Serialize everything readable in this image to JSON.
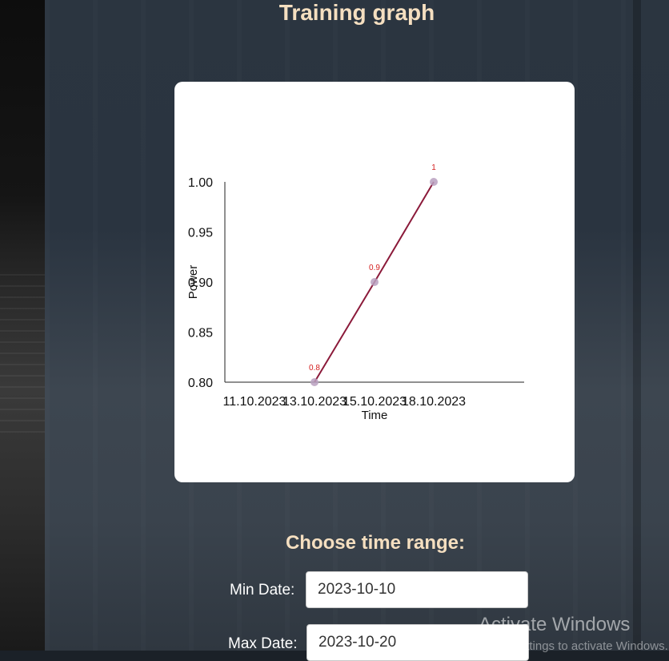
{
  "page": {
    "title": "Training graph"
  },
  "chart_data": {
    "type": "line",
    "xlabel": "Time",
    "ylabel": "Power",
    "x_ticks": [
      "11.10.2023",
      "13.10.2023",
      "15.10.2023",
      "18.10.2023"
    ],
    "yticks": [
      "0.80",
      "0.85",
      "0.90",
      "0.95",
      "1.00"
    ],
    "ylim": [
      0.8,
      1.0
    ],
    "series": [
      {
        "points": [
          {
            "x": "13.10.2023",
            "y": 0.8,
            "label": "0.8"
          },
          {
            "x": "15.10.2023",
            "y": 0.9,
            "label": "0.9"
          },
          {
            "x": "18.10.2023",
            "y": 1.0,
            "label": "1"
          }
        ],
        "color": "#8b1a3a"
      }
    ],
    "point_color": "#b8a0c0",
    "label_color": "#d42020",
    "grid": false
  },
  "range": {
    "title": "Choose time range:",
    "min_label": "Min Date:",
    "min_value": "2023-10-10",
    "max_label": "Max Date:",
    "max_value": "2023-10-20"
  },
  "watermark": {
    "line1": "Activate Windows",
    "line2": "Go to Settings to activate Windows."
  }
}
